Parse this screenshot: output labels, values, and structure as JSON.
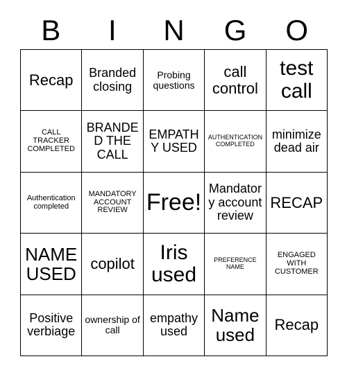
{
  "card": {
    "header_letters": [
      "B",
      "I",
      "N",
      "G",
      "O"
    ],
    "rows": [
      [
        {
          "text": "Recap",
          "size": "lg"
        },
        {
          "text": "Branded closing",
          "size": "md"
        },
        {
          "text": "Probing questions",
          "size": "sm"
        },
        {
          "text": "call control",
          "size": "lg"
        },
        {
          "text": "test call",
          "size": "xxl"
        }
      ],
      [
        {
          "text": "CALL TRACKER COMPLETED",
          "size": "xs"
        },
        {
          "text": "BRANDED THE CALL",
          "size": "md"
        },
        {
          "text": "EMPATHY USED",
          "size": "md"
        },
        {
          "text": "AUTHENTICATION COMPLETED",
          "size": "xxs"
        },
        {
          "text": "minimize dead air",
          "size": "md"
        }
      ],
      [
        {
          "text": "Authentication completed",
          "size": "xs"
        },
        {
          "text": "MANDATORY ACCOUNT REVIEW",
          "size": "xs"
        },
        {
          "text": "Free!",
          "size": "free"
        },
        {
          "text": "Mandatory account review",
          "size": "md"
        },
        {
          "text": "RECAP",
          "size": "lg"
        }
      ],
      [
        {
          "text": "NAME USED",
          "size": "xl"
        },
        {
          "text": "copilot",
          "size": "lg"
        },
        {
          "text": "Iris used",
          "size": "xxl"
        },
        {
          "text": "PREFERENCE NAME",
          "size": "xxs"
        },
        {
          "text": "ENGAGED WITH CUSTOMER",
          "size": "xs"
        }
      ],
      [
        {
          "text": "Positive verbiage",
          "size": "md"
        },
        {
          "text": "ownership of call",
          "size": "sm"
        },
        {
          "text": "empathy used",
          "size": "md"
        },
        {
          "text": "Name used",
          "size": "xl"
        },
        {
          "text": "Recap",
          "size": "lg"
        }
      ]
    ]
  }
}
